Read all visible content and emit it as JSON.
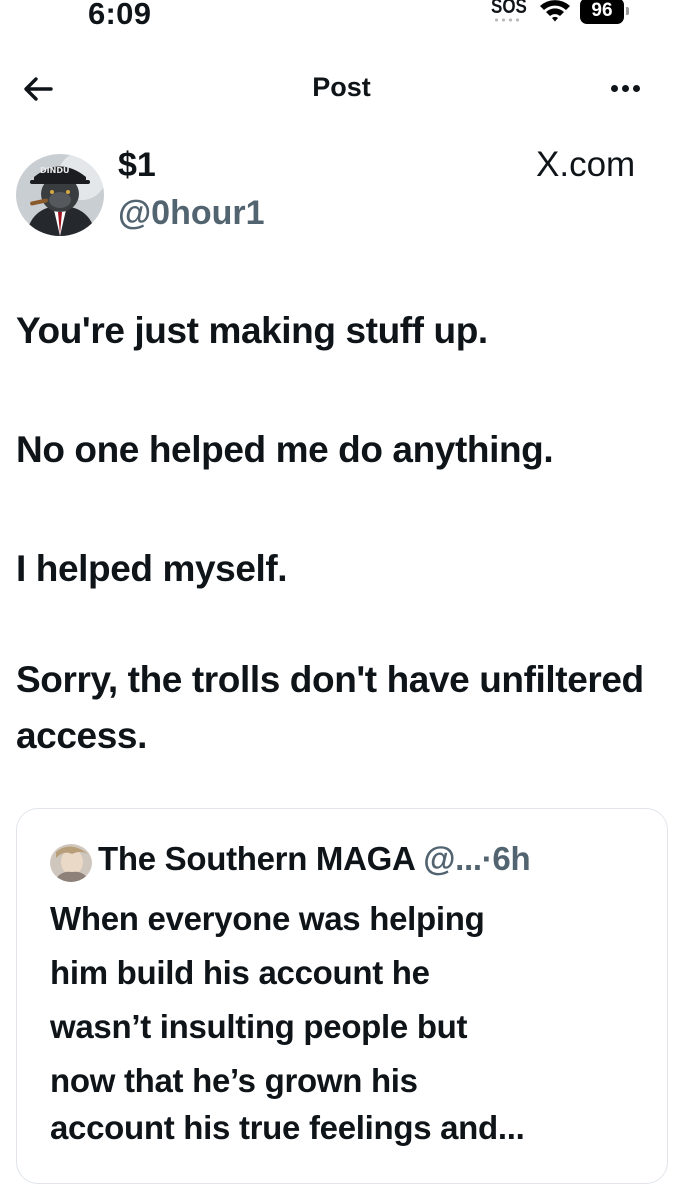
{
  "status_bar": {
    "time": "6:09",
    "sos": "SOS",
    "battery": "96",
    "icons": [
      "wifi-icon",
      "battery-icon"
    ]
  },
  "nav": {
    "title": "Post",
    "back_icon": "arrow-left-icon",
    "more_icon": "more-dots-icon"
  },
  "author": {
    "display_name": "$1",
    "handle": "@0hour1",
    "source": "X.com",
    "avatar_cap_text": "DINDU"
  },
  "post": {
    "paragraphs": [
      "You're just making stuff up.",
      "No one helped me do anything.",
      "I helped myself.",
      "Sorry, the trolls don't have unfiltered access."
    ]
  },
  "quoted_post": {
    "display_name": "The Southern MAGA",
    "handle": "@...",
    "separator": "·",
    "time": "6h",
    "lines": [
      "When everyone was helping",
      "him build his account he",
      "wasn’t insulting people but",
      "now that he’s grown his",
      "account his true feelings and..."
    ]
  },
  "colors": {
    "text": "#0f1419",
    "secondary": "#536471",
    "border": "#e1e5ea",
    "background": "#ffffff"
  }
}
